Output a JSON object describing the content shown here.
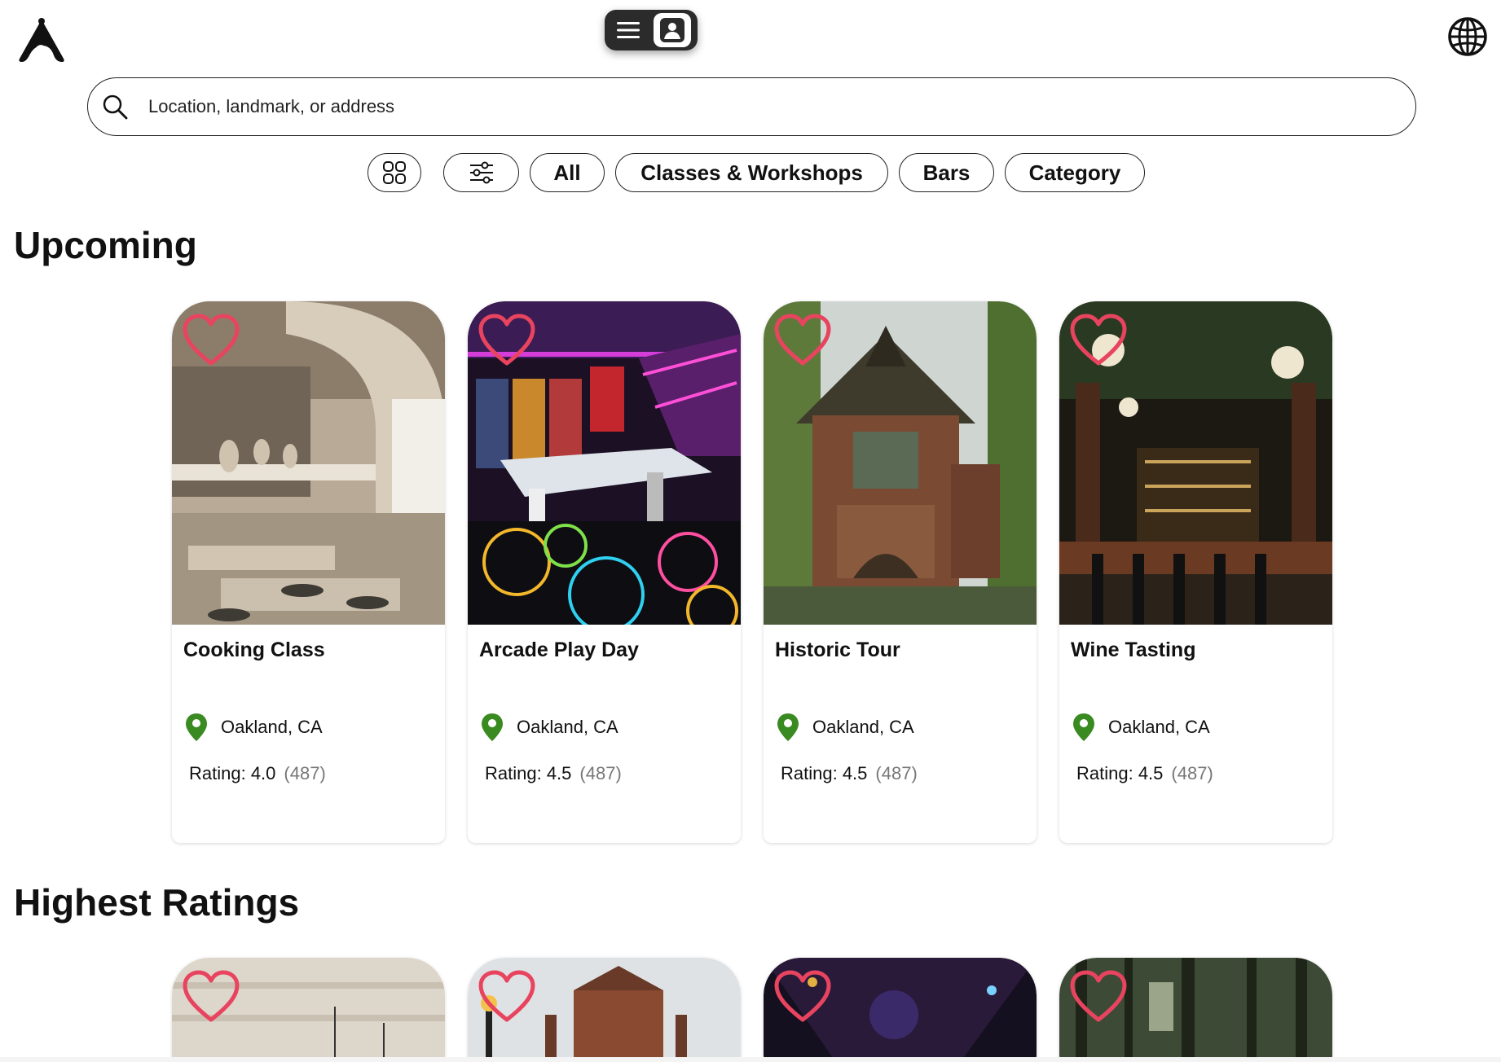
{
  "header": {
    "logo_icon": "app-logo-icon",
    "menu_icon": "hamburger-menu-icon",
    "profile_icon": "profile-card-icon",
    "language_icon": "globe-icon"
  },
  "search": {
    "icon": "search-icon",
    "placeholder": "Location, landmark, or address"
  },
  "filters": {
    "grid_icon": "grid-view-icon",
    "sliders_icon": "filter-sliders-icon",
    "chips": [
      "All",
      "Classes & Workshops",
      "Bars",
      "Category"
    ]
  },
  "sections": {
    "upcoming": {
      "title": "Upcoming",
      "cards": [
        {
          "title": "Cooking Class",
          "location": "Oakland, CA",
          "rating": "Rating: 4.0",
          "count": "(487)"
        },
        {
          "title": "Arcade Play Day",
          "location": "Oakland, CA",
          "rating": "Rating: 4.5",
          "count": "(487)"
        },
        {
          "title": "Historic Tour",
          "location": "Oakland, CA",
          "rating": "Rating: 4.5",
          "count": "(487)"
        },
        {
          "title": "Wine Tasting",
          "location": "Oakland, CA",
          "rating": "Rating: 4.5",
          "count": "(487)"
        }
      ]
    },
    "highest": {
      "title": "Highest Ratings"
    }
  },
  "colors": {
    "heart": "#e8445f",
    "pin": "#3a8a22",
    "pill": "#2b2b2b"
  }
}
